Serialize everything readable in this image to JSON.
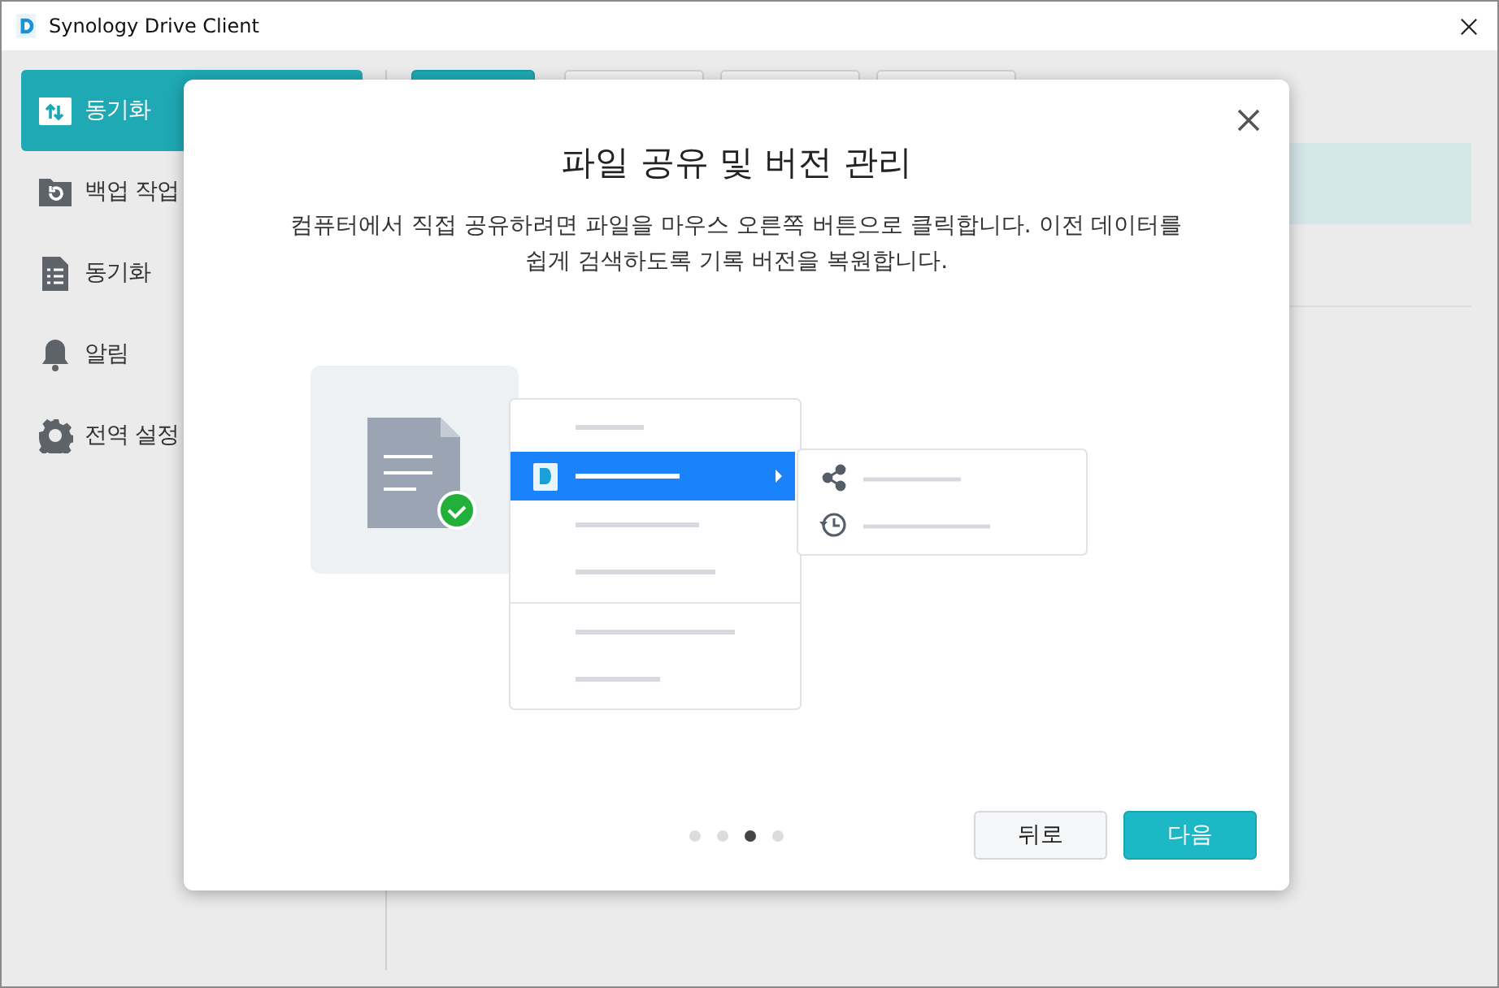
{
  "window": {
    "title": "Synology Drive Client"
  },
  "sidebar": {
    "items": [
      {
        "label": "동기화",
        "kind": "sync",
        "selected": true
      },
      {
        "label": "백업 작업",
        "kind": "backup",
        "selected": false
      },
      {
        "label": "동기화",
        "kind": "log",
        "selected": false
      },
      {
        "label": "알림",
        "kind": "bell",
        "selected": false
      },
      {
        "label": "전역 설정",
        "kind": "gear",
        "selected": false
      }
    ]
  },
  "tabs": [
    {
      "selected": true
    },
    {
      "selected": false
    },
    {
      "selected": false
    },
    {
      "selected": false
    }
  ],
  "list": {
    "rows": [
      {
        "selected": true
      },
      {
        "selected": false
      }
    ]
  },
  "dialog": {
    "title": "파일 공유 및 버전 관리",
    "description": [
      "컴퓨터에서 직접 공유하려면 파일을 마우스 오른쪽 버튼으로 클릭합니다. 이전 데이터를",
      "쉽게 검색하도록 기록 버전을 복원합니다."
    ],
    "pages": [
      {
        "selected": false
      },
      {
        "selected": false
      },
      {
        "selected": true
      },
      {
        "selected": false
      }
    ],
    "buttons": [
      {
        "label": "뒤로",
        "kind": "secondary"
      },
      {
        "label": "다음",
        "kind": "primary"
      }
    ]
  }
}
